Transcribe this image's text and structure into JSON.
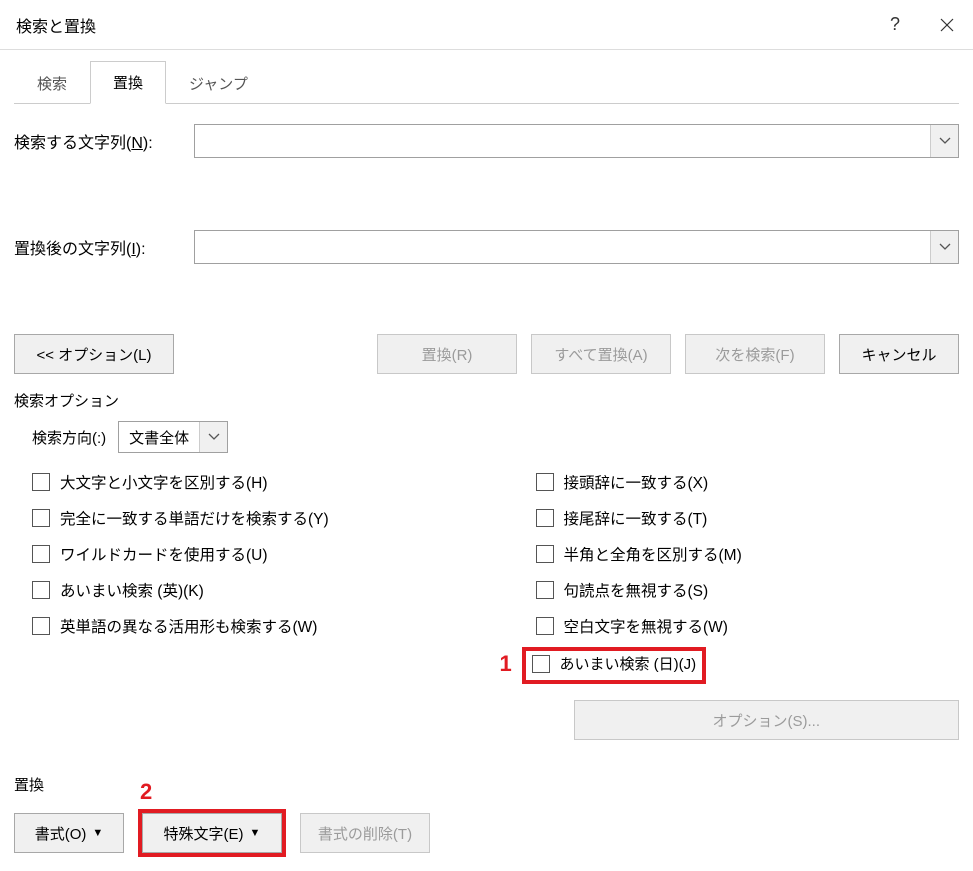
{
  "title": "検索と置換",
  "titlebar": {
    "help": "?",
    "close": "×"
  },
  "tabs": {
    "search": "検索",
    "replace": "置換",
    "jump": "ジャンプ"
  },
  "form": {
    "find_label_pre": "検索する文字列(",
    "find_label_key": "N",
    "find_label_post": "):",
    "replace_label_pre": "置換後の文字列(",
    "replace_label_key": "I",
    "replace_label_post": "):",
    "find_value": "",
    "replace_value": ""
  },
  "buttons": {
    "options": "<< オプション(L)",
    "replace": "置換(R)",
    "replace_all": "すべて置換(A)",
    "find_next": "次を検索(F)",
    "cancel": "キャンセル"
  },
  "search_options": {
    "legend": "検索オプション",
    "direction_label": "検索方向(:)",
    "direction_value": "文書全体",
    "left": {
      "match_case": "大文字と小文字を区別する(H)",
      "whole_word": "完全に一致する単語だけを検索する(Y)",
      "wildcards": "ワイルドカードを使用する(U)",
      "fuzzy_en": "あいまい検索 (英)(K)",
      "word_forms": "英単語の異なる活用形も検索する(W)"
    },
    "right": {
      "prefix": "接頭辞に一致する(X)",
      "suffix": "接尾辞に一致する(T)",
      "width": "半角と全角を区別する(M)",
      "punctuation": "句読点を無視する(S)",
      "whitespace": "空白文字を無視する(W)",
      "fuzzy_jp": "あいまい検索 (日)(J)"
    },
    "options_btn": "オプション(S)..."
  },
  "replace_section": {
    "legend": "置換",
    "format": "書式(O)",
    "special": "特殊文字(E)",
    "no_format": "書式の削除(T)"
  },
  "annotations": {
    "one": "1",
    "two": "2"
  }
}
